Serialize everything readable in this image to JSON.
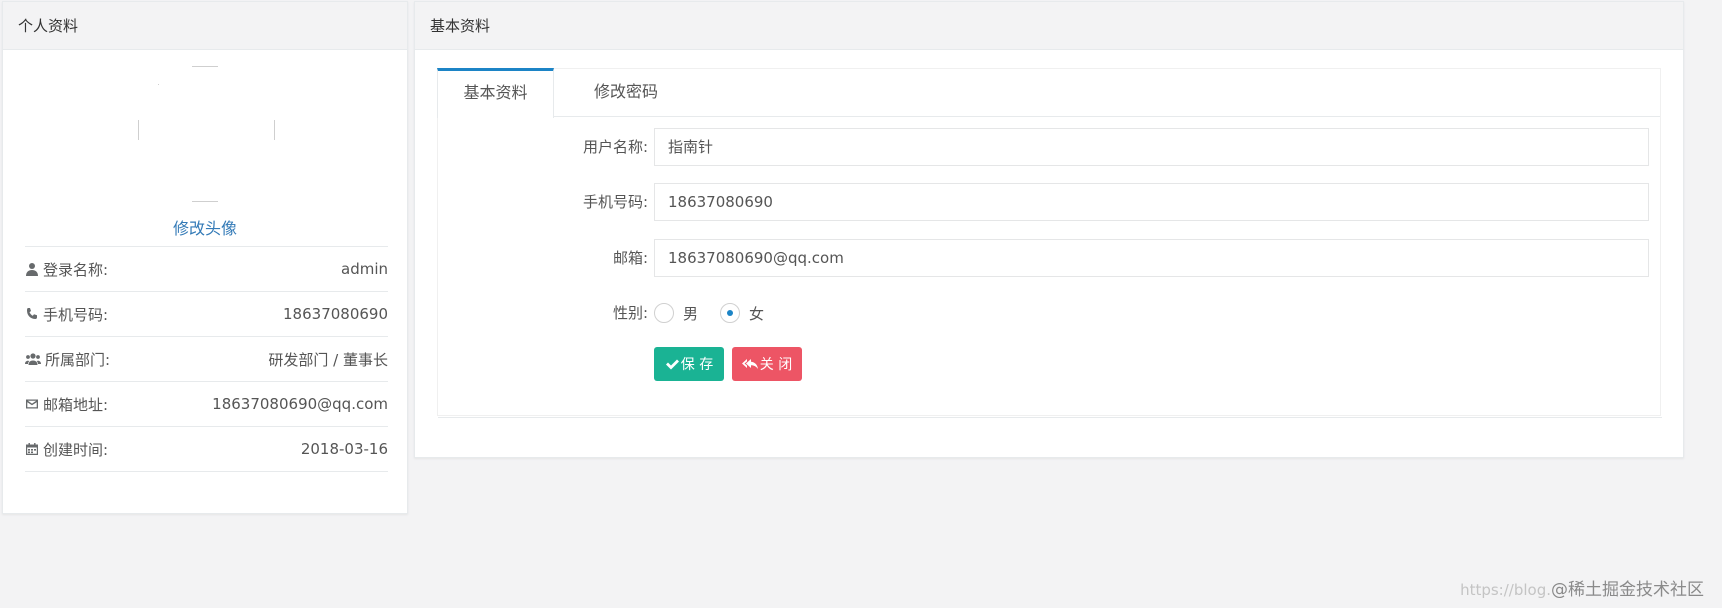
{
  "left_panel": {
    "title": "个人资料",
    "change_avatar": "修改头像",
    "info": [
      {
        "label": "登录名称:",
        "value": "admin",
        "icon": "user-icon"
      },
      {
        "label": "手机号码:",
        "value": "18637080690",
        "icon": "phone-icon"
      },
      {
        "label": "所属部门:",
        "value": "研发部门 / 董事长",
        "icon": "users-icon"
      },
      {
        "label": "邮箱地址:",
        "value": "18637080690@qq.com",
        "icon": "envelope-icon"
      },
      {
        "label": "创建时间:",
        "value": "2018-03-16",
        "icon": "calendar-icon"
      }
    ]
  },
  "right_panel": {
    "title": "基本资料",
    "tabs": [
      {
        "label": "基本资料",
        "active": true
      },
      {
        "label": "修改密码",
        "active": false
      }
    ],
    "form": {
      "username_label": "用户名称:",
      "username_value": "指南针",
      "phone_label": "手机号码:",
      "phone_value": "18637080690",
      "email_label": "邮箱:",
      "email_value": "18637080690@qq.com",
      "gender_label": "性别:",
      "gender_options": [
        "男",
        "女"
      ],
      "gender_selected": "女",
      "save_label": "保 存",
      "close_label": "关 闭"
    }
  },
  "watermark": {
    "prefix": "https://blog.",
    "text": "@稀土掘金技术社区"
  },
  "colors": {
    "accent": "#1c84c6",
    "save": "#1ab394",
    "close": "#ed5565",
    "link": "#337ab7"
  }
}
